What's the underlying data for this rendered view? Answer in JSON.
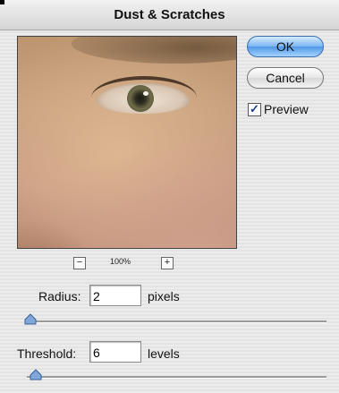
{
  "window": {
    "title": "Dust & Scratches"
  },
  "preview": {
    "zoom": "100%",
    "zoom_out_glyph": "−",
    "zoom_in_glyph": "+"
  },
  "buttons": {
    "ok": "OK",
    "cancel": "Cancel"
  },
  "preview_toggle": {
    "label": "Preview",
    "checked": true,
    "check_glyph": "✓"
  },
  "radius": {
    "label": "Radius:",
    "value": "2",
    "unit": "pixels",
    "slider_level": 0.0
  },
  "threshold": {
    "label": "Threshold:",
    "value": "6",
    "unit": "levels",
    "slider_level": 0.02
  },
  "colors": {
    "ok_accent": "#4d97e6",
    "slider_thumb": "#7fa7dc"
  },
  "icons": [
    "zoom-out-icon",
    "zoom-in-icon",
    "checkmark-icon",
    "slider-thumb-icon"
  ]
}
